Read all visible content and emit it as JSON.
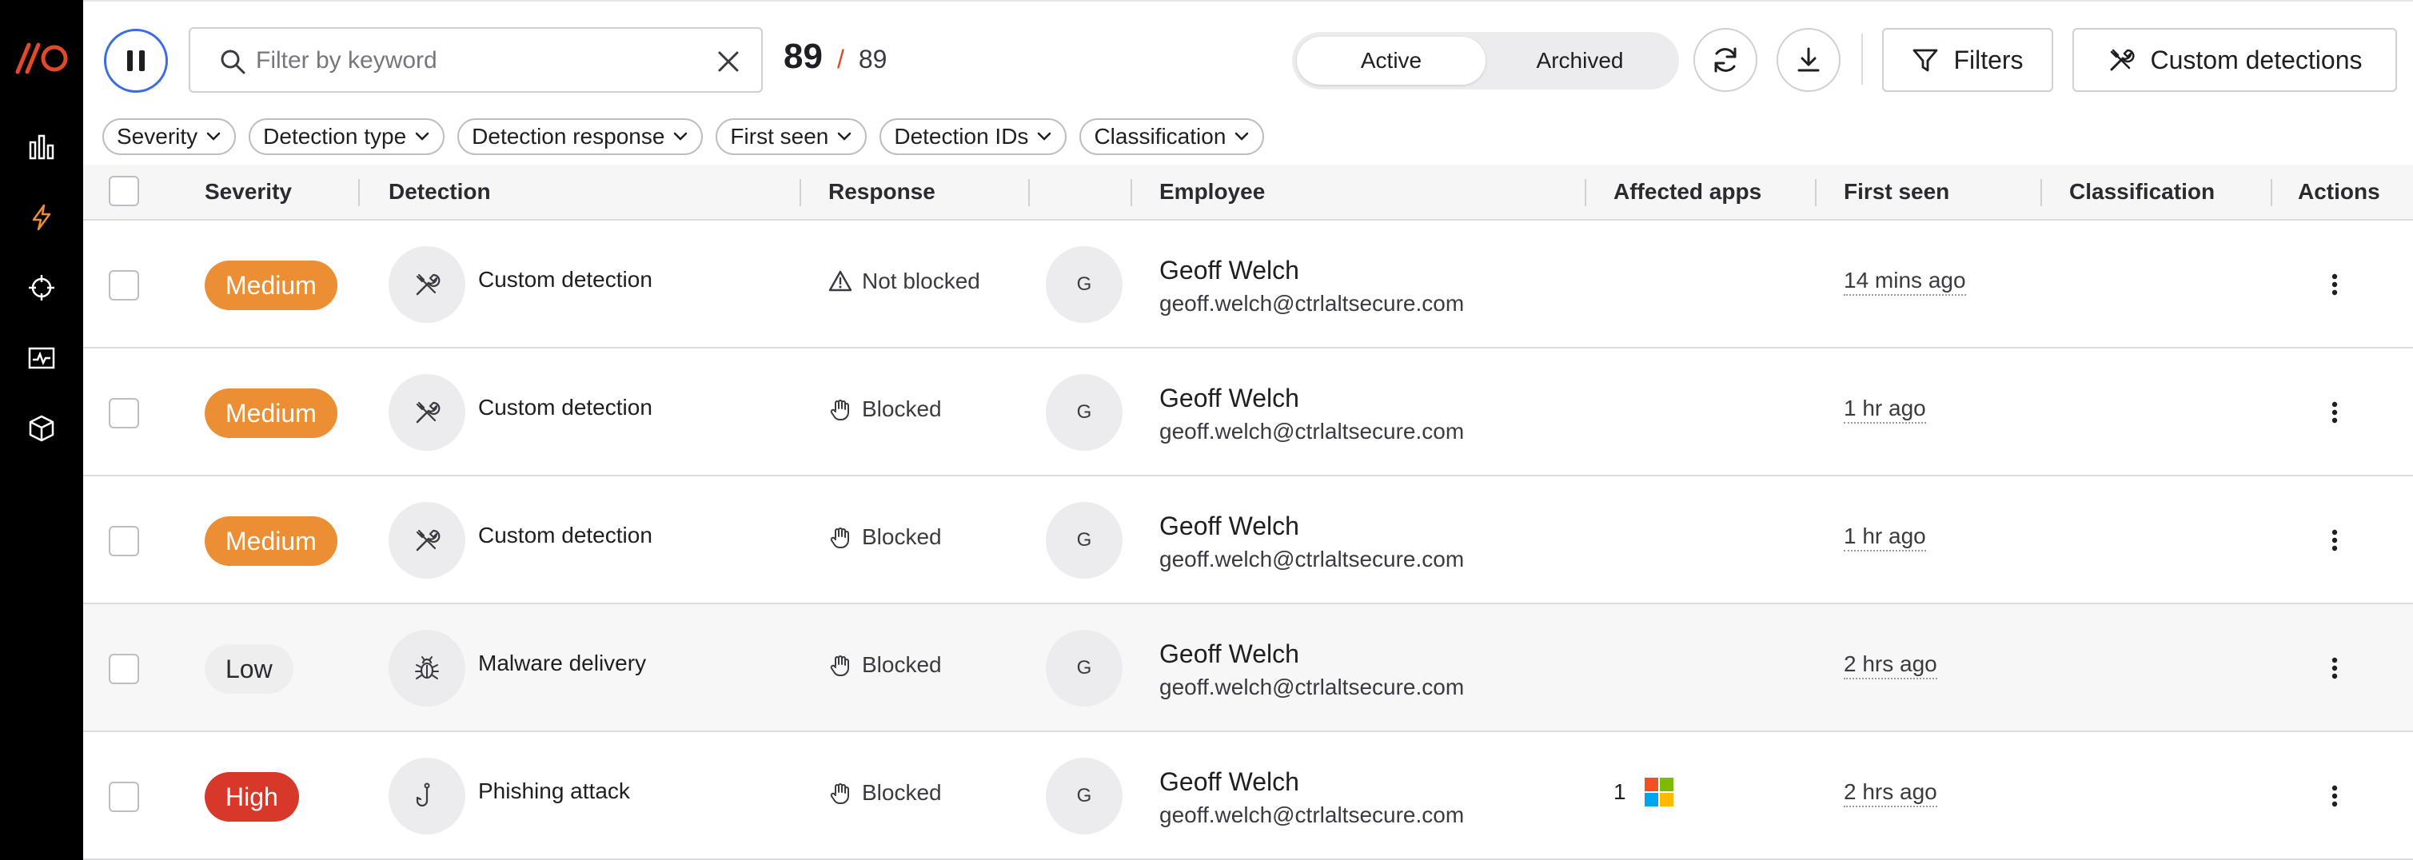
{
  "sidebar": {
    "logo_text": "//O",
    "items": [
      {
        "name": "analytics",
        "icon": "bar-chart-icon"
      },
      {
        "name": "detections",
        "icon": "lightning-icon",
        "active": true
      },
      {
        "name": "targets",
        "icon": "crosshair-icon"
      },
      {
        "name": "activity",
        "icon": "activity-icon"
      },
      {
        "name": "apps",
        "icon": "cube-icon"
      }
    ]
  },
  "toolbar": {
    "search_placeholder": "Filter by keyword",
    "search_value": "",
    "count_shown": "89",
    "count_separator": "/",
    "count_total": "89",
    "segments": [
      "Active",
      "Archived"
    ],
    "active_segment": "Active",
    "filters_label": "Filters",
    "custom_detections_label": "Custom detections"
  },
  "filter_chips": [
    "Severity",
    "Detection type",
    "Detection response",
    "First seen",
    "Detection IDs",
    "Classification"
  ],
  "table": {
    "columns": {
      "severity": "Severity",
      "detection": "Detection",
      "response": "Response",
      "employee": "Employee",
      "affected_apps": "Affected apps",
      "first_seen": "First seen",
      "classification": "Classification",
      "actions": "Actions"
    },
    "rows": [
      {
        "severity": "Medium",
        "severity_level": "medium",
        "detection_icon": "tools-icon",
        "detection": "Custom detection",
        "response_icon": "warning-icon",
        "response": "Not blocked",
        "avatar": "G",
        "employee_name": "Geoff Welch",
        "employee_email": "geoff.welch@ctrlaltsecure.com",
        "affected_count": "",
        "first_seen": "14 mins ago",
        "classification": ""
      },
      {
        "severity": "Medium",
        "severity_level": "medium",
        "detection_icon": "tools-icon",
        "detection": "Custom detection",
        "response_icon": "hand-icon",
        "response": "Blocked",
        "avatar": "G",
        "employee_name": "Geoff Welch",
        "employee_email": "geoff.welch@ctrlaltsecure.com",
        "affected_count": "",
        "first_seen": "1 hr ago",
        "classification": ""
      },
      {
        "severity": "Medium",
        "severity_level": "medium",
        "detection_icon": "tools-icon",
        "detection": "Custom detection",
        "response_icon": "hand-icon",
        "response": "Blocked",
        "avatar": "G",
        "employee_name": "Geoff Welch",
        "employee_email": "geoff.welch@ctrlaltsecure.com",
        "affected_count": "",
        "first_seen": "1 hr ago",
        "classification": ""
      },
      {
        "severity": "Low",
        "severity_level": "low",
        "detection_icon": "bug-icon",
        "detection": "Malware delivery",
        "response_icon": "hand-icon",
        "response": "Blocked",
        "avatar": "G",
        "employee_name": "Geoff Welch",
        "employee_email": "geoff.welch@ctrlaltsecure.com",
        "affected_count": "",
        "first_seen": "2 hrs ago",
        "classification": ""
      },
      {
        "severity": "High",
        "severity_level": "high",
        "detection_icon": "hook-icon",
        "detection": "Phishing attack",
        "response_icon": "hand-icon",
        "response": "Blocked",
        "avatar": "G",
        "employee_name": "Geoff Welch",
        "employee_email": "geoff.welch@ctrlaltsecure.com",
        "affected_count": "1",
        "affected_app_icon": "microsoft-icon",
        "first_seen": "2 hrs ago",
        "classification": ""
      }
    ]
  },
  "colors": {
    "accent_blue": "#3a6ee0",
    "logo_red": "#e0492a",
    "medium": "#ec8e33",
    "high": "#d8382a",
    "low": "#eeeeef"
  }
}
